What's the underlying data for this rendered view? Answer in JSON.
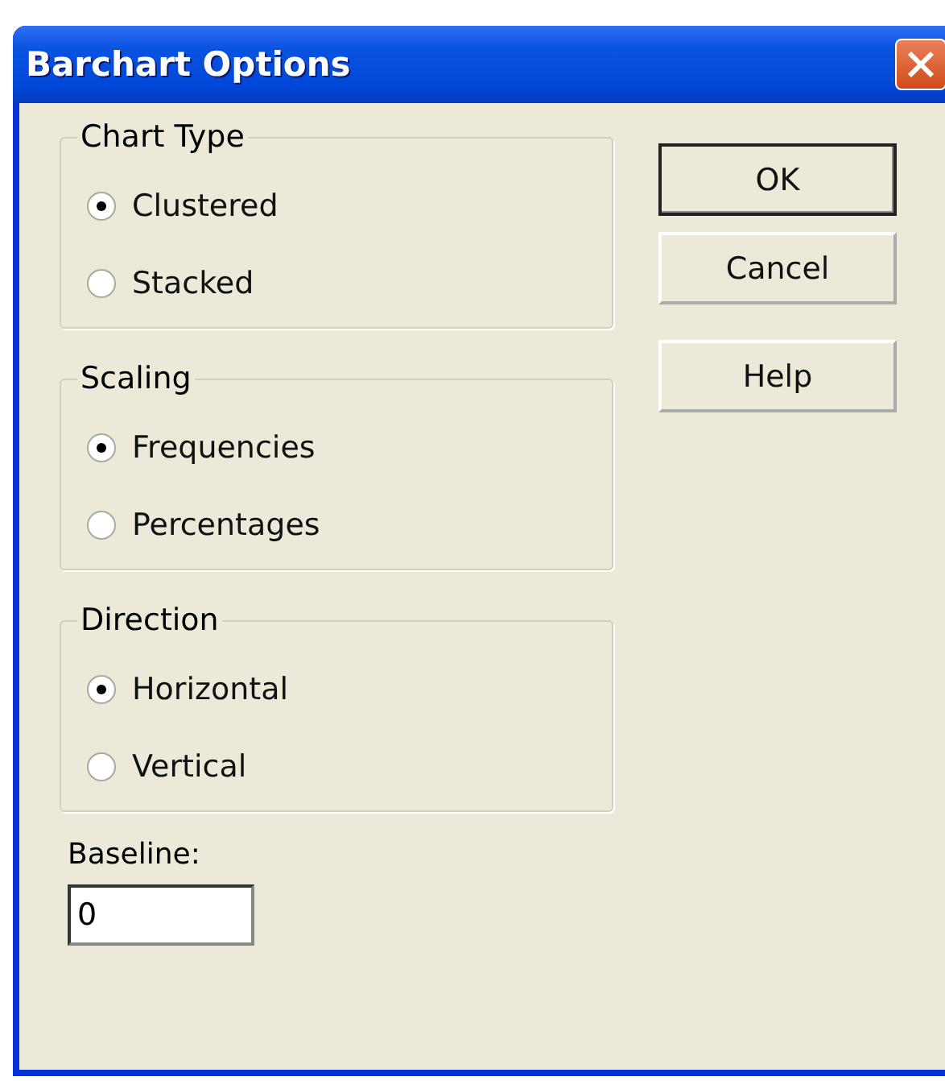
{
  "window": {
    "title": "Barchart Options"
  },
  "groups": [
    {
      "title": "Chart Type",
      "options": [
        {
          "label": "Clustered",
          "selected": true
        },
        {
          "label": "Stacked",
          "selected": false
        }
      ]
    },
    {
      "title": "Scaling",
      "options": [
        {
          "label": "Frequencies",
          "selected": true
        },
        {
          "label": "Percentages",
          "selected": false
        }
      ]
    },
    {
      "title": "Direction",
      "options": [
        {
          "label": "Horizontal",
          "selected": true
        },
        {
          "label": "Vertical",
          "selected": false
        }
      ]
    }
  ],
  "buttons": [
    {
      "label": "OK",
      "default": true
    },
    {
      "label": "Cancel",
      "default": false
    },
    {
      "label": "Help",
      "default": false
    }
  ],
  "baseline": {
    "label": "Baseline:",
    "value": "0"
  }
}
